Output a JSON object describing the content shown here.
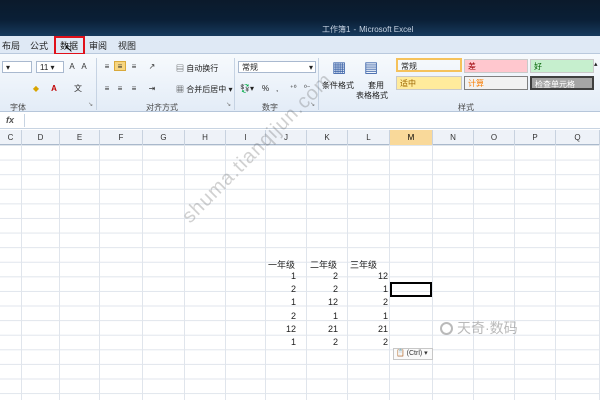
{
  "window": {
    "title_doc": "工作簿1",
    "title_app": "Microsoft Excel"
  },
  "tabs": [
    {
      "label": "布局"
    },
    {
      "label": "公式"
    },
    {
      "label": "数据"
    },
    {
      "label": "审阅"
    },
    {
      "label": "视图"
    }
  ],
  "ribbon": {
    "font": {
      "size": "11",
      "group_label": "字体"
    },
    "alignment": {
      "wrap_text": "自动换行",
      "merge_center": "合并后居中",
      "group_label": "对齐方式"
    },
    "number": {
      "format": "常规",
      "percent": "%",
      "comma": ",",
      "group_label": "数字"
    },
    "styles": {
      "conditional_format": "条件格式",
      "format_table": "套用",
      "format_table2": "表格格式",
      "group_label": "样式",
      "cells": [
        {
          "label": "常规",
          "bg": "#ffffff",
          "color": "#222222"
        },
        {
          "label": "差",
          "bg": "#ffc7ce",
          "color": "#9c0006"
        },
        {
          "label": "好",
          "bg": "#c6efce",
          "color": "#006100"
        },
        {
          "label": "适中",
          "bg": "#ffeb9c",
          "color": "#9c6500"
        },
        {
          "label": "计算",
          "bg": "#f2f2f2",
          "color": "#fa7d00"
        },
        {
          "label": "检查单元格",
          "bg": "#a5a5a5",
          "color": "#ffffff"
        }
      ]
    }
  },
  "formula_bar": {
    "fx": "fx",
    "value": ""
  },
  "columns": [
    "C",
    "D",
    "E",
    "F",
    "G",
    "H",
    "I",
    "J",
    "K",
    "L",
    "M",
    "N",
    "O",
    "P",
    "Q"
  ],
  "active_column": "M",
  "table": {
    "headers": [
      "一年级",
      "二年级",
      "三年级"
    ],
    "rows": [
      [
        "1",
        "2",
        "12"
      ],
      [
        "2",
        "2",
        "1"
      ],
      [
        "1",
        "12",
        "2"
      ],
      [
        "2",
        "1",
        "1"
      ],
      [
        "12",
        "21",
        "21"
      ],
      [
        "1",
        "2",
        "2"
      ]
    ]
  },
  "paste_options": "(Ctrl)",
  "watermark": {
    "text": "shuma.tianqijun.com",
    "logo": "天奇·数码"
  },
  "colors": {
    "highlight": "#e0101a",
    "selection": "#000000",
    "active_header": "#f9d99a"
  }
}
